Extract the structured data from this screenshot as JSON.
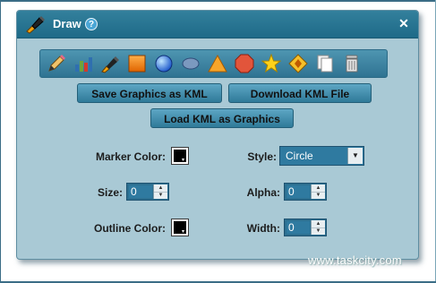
{
  "window": {
    "title": "Draw",
    "help_icon": "help-icon",
    "close_label": "✕"
  },
  "toolbar": {
    "tools": [
      {
        "name": "freehand-pencil-icon"
      },
      {
        "name": "bar-chart-icon"
      },
      {
        "name": "marker-icon"
      },
      {
        "name": "rectangle-icon"
      },
      {
        "name": "circle-icon"
      },
      {
        "name": "ellipse-icon"
      },
      {
        "name": "triangle-icon"
      },
      {
        "name": "octagon-icon"
      },
      {
        "name": "star-icon"
      },
      {
        "name": "diamond-icon"
      },
      {
        "name": "copy-icon"
      },
      {
        "name": "trash-icon"
      }
    ]
  },
  "buttons": {
    "save_kml": "Save Graphics as KML",
    "download_kml": "Download KML File",
    "load_kml": "Load KML as Graphics"
  },
  "form": {
    "marker_color_label": "Marker Color:",
    "style_label": "Style:",
    "style_value": "Circle",
    "size_label": "Size:",
    "size_value": "0",
    "alpha_label": "Alpha:",
    "alpha_value": "0",
    "outline_color_label": "Outline Color:",
    "width_label": "Width:",
    "width_value": "0",
    "marker_color": "#000000",
    "outline_color": "#000000"
  },
  "watermark": "www.taskcity.com"
}
